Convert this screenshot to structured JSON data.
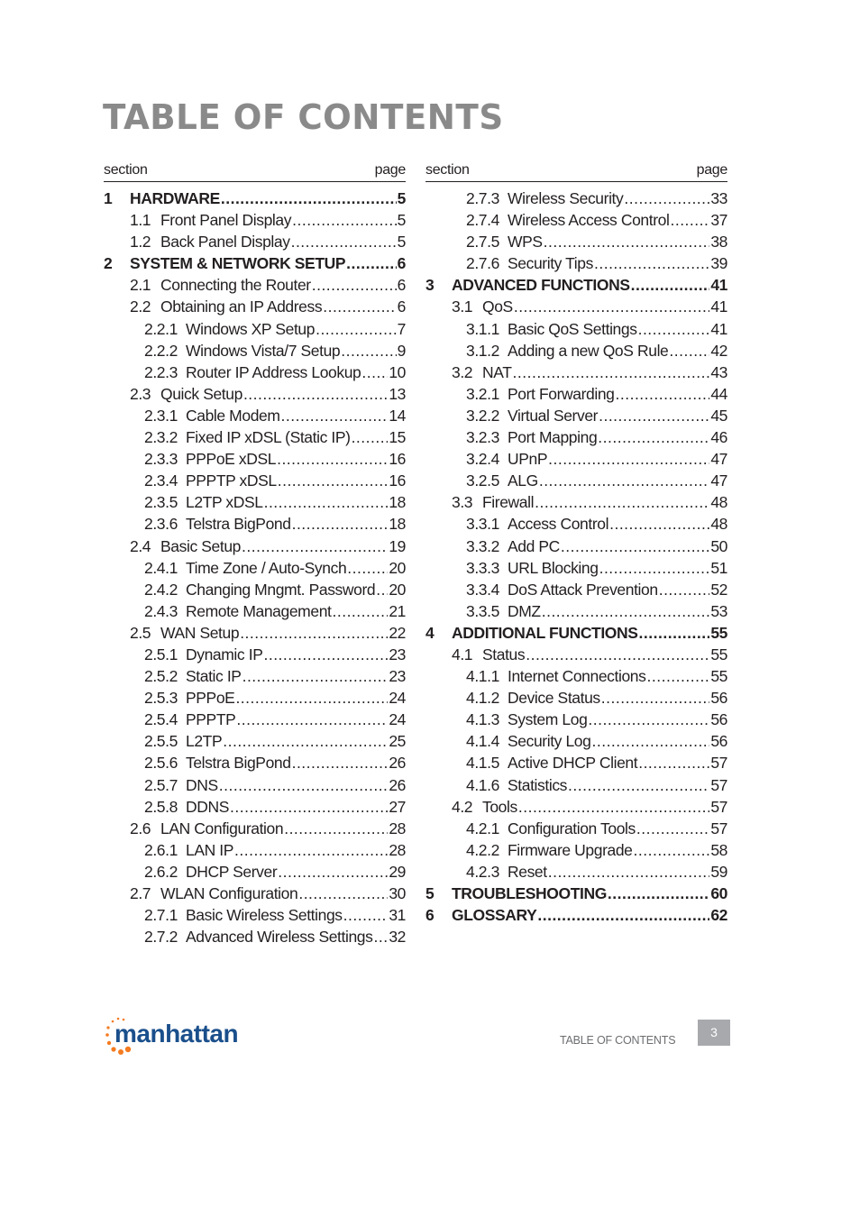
{
  "title": "TABLE OF CONTENTS",
  "column_header": {
    "section": "section",
    "page": "page"
  },
  "left": [
    {
      "level": 1,
      "num": "1",
      "label": "HARDWARE",
      "page": "5"
    },
    {
      "level": 2,
      "num": "1.1",
      "label": "Front Panel Display",
      "page": "5"
    },
    {
      "level": 2,
      "num": "1.2",
      "label": "Back Panel Display",
      "page": "5"
    },
    {
      "level": 1,
      "num": "2",
      "label": "SYSTEM & NETWORK SETUP",
      "page": "6"
    },
    {
      "level": 2,
      "num": "2.1",
      "label": "Connecting the Router",
      "page": "6"
    },
    {
      "level": 2,
      "num": "2.2",
      "label": "Obtaining an IP Address",
      "page": "6"
    },
    {
      "level": 3,
      "num": "2.2.1",
      "label": "Windows XP Setup",
      "page": "7"
    },
    {
      "level": 3,
      "num": "2.2.2",
      "label": "Windows Vista/7 Setup",
      "page": "9"
    },
    {
      "level": 3,
      "num": "2.2.3",
      "label": "Router IP Address Lookup",
      "page": "10"
    },
    {
      "level": 2,
      "num": "2.3",
      "label": "Quick Setup",
      "page": "13"
    },
    {
      "level": 3,
      "num": "2.3.1",
      "label": "Cable Modem",
      "page": "14"
    },
    {
      "level": 3,
      "num": "2.3.2",
      "label": "Fixed IP xDSL (Static IP)",
      "page": "15"
    },
    {
      "level": 3,
      "num": "2.3.3",
      "label": "PPPoE xDSL",
      "page": "16"
    },
    {
      "level": 3,
      "num": "2.3.4",
      "label": "PPPTP xDSL",
      "page": "16"
    },
    {
      "level": 3,
      "num": "2.3.5",
      "label": "L2TP xDSL",
      "page": "18"
    },
    {
      "level": 3,
      "num": "2.3.6",
      "label": "Telstra BigPond",
      "page": "18"
    },
    {
      "level": 2,
      "num": "2.4",
      "label": "Basic Setup",
      "page": "19"
    },
    {
      "level": 3,
      "num": "2.4.1",
      "label": "Time Zone / Auto-Synch",
      "page": "20"
    },
    {
      "level": 3,
      "num": "2.4.2",
      "label": "Changing Mngmt. Password",
      "page": "20"
    },
    {
      "level": 3,
      "num": "2.4.3",
      "label": "Remote Management",
      "page": "21"
    },
    {
      "level": 2,
      "num": "2.5",
      "label": "WAN Setup",
      "page": "22"
    },
    {
      "level": 3,
      "num": "2.5.1",
      "label": "Dynamic IP",
      "page": "23"
    },
    {
      "level": 3,
      "num": "2.5.2",
      "label": "Static IP",
      "page": "23"
    },
    {
      "level": 3,
      "num": "2.5.3",
      "label": "PPPoE",
      "page": "24"
    },
    {
      "level": 3,
      "num": "2.5.4",
      "label": "PPPTP",
      "page": "24"
    },
    {
      "level": 3,
      "num": "2.5.5",
      "label": "L2TP",
      "page": "25"
    },
    {
      "level": 3,
      "num": "2.5.6",
      "label": "Telstra BigPond",
      "page": "26"
    },
    {
      "level": 3,
      "num": "2.5.7",
      "label": "DNS",
      "page": "26"
    },
    {
      "level": 3,
      "num": "2.5.8",
      "label": "DDNS",
      "page": "27"
    },
    {
      "level": 2,
      "num": "2.6",
      "label": "LAN Configuration",
      "page": "28"
    },
    {
      "level": 3,
      "num": "2.6.1",
      "label": "LAN IP",
      "page": "28"
    },
    {
      "level": 3,
      "num": "2.6.2",
      "label": "DHCP Server",
      "page": "29"
    },
    {
      "level": 2,
      "num": "2.7",
      "label": "WLAN Configuration",
      "page": "30"
    },
    {
      "level": 3,
      "num": "2.7.1",
      "label": "Basic Wireless Settings",
      "page": "31"
    },
    {
      "level": 3,
      "num": "2.7.2",
      "label": "Advanced Wireless Settings",
      "page": "32"
    }
  ],
  "right": [
    {
      "level": 3,
      "num": "2.7.3",
      "label": "Wireless Security",
      "page": "33"
    },
    {
      "level": 3,
      "num": "2.7.4",
      "label": "Wireless Access Control",
      "page": "37"
    },
    {
      "level": 3,
      "num": "2.7.5",
      "label": "WPS",
      "page": "38"
    },
    {
      "level": 3,
      "num": "2.7.6",
      "label": "Security Tips",
      "page": "39"
    },
    {
      "level": 1,
      "num": "3",
      "label": "ADVANCED FUNCTIONS",
      "page": "41"
    },
    {
      "level": 2,
      "num": "3.1",
      "label": "QoS",
      "page": "41"
    },
    {
      "level": 3,
      "num": "3.1.1",
      "label": "Basic QoS Settings",
      "page": "41"
    },
    {
      "level": 3,
      "num": "3.1.2",
      "label": "Adding a new QoS Rule",
      "page": "42"
    },
    {
      "level": 2,
      "num": "3.2",
      "label": "NAT",
      "page": "43"
    },
    {
      "level": 3,
      "num": "3.2.1",
      "label": "Port Forwarding",
      "page": "44"
    },
    {
      "level": 3,
      "num": "3.2.2",
      "label": "Virtual Server",
      "page": "45"
    },
    {
      "level": 3,
      "num": "3.2.3",
      "label": "Port Mapping",
      "page": "46"
    },
    {
      "level": 3,
      "num": "3.2.4",
      "label": "UPnP",
      "page": "47"
    },
    {
      "level": 3,
      "num": "3.2.5",
      "label": "ALG",
      "page": "47"
    },
    {
      "level": 2,
      "num": "3.3",
      "label": "Firewall",
      "page": "48"
    },
    {
      "level": 3,
      "num": "3.3.1",
      "label": "Access Control",
      "page": "48"
    },
    {
      "level": 3,
      "num": "3.3.2",
      "label": "Add PC",
      "page": "50"
    },
    {
      "level": 3,
      "num": "3.3.3",
      "label": "URL Blocking",
      "page": "51"
    },
    {
      "level": 3,
      "num": "3.3.4",
      "label": "DoS Attack Prevention",
      "page": "52"
    },
    {
      "level": 3,
      "num": "3.3.5",
      "label": "DMZ",
      "page": "53"
    },
    {
      "level": 1,
      "num": "4",
      "label": "ADDITIONAL FUNCTIONS",
      "page": "55"
    },
    {
      "level": 2,
      "num": "4.1",
      "label": "Status",
      "page": "55"
    },
    {
      "level": 3,
      "num": "4.1.1",
      "label": "Internet Connections",
      "page": "55"
    },
    {
      "level": 3,
      "num": "4.1.2",
      "label": "Device Status",
      "page": "56"
    },
    {
      "level": 3,
      "num": "4.1.3",
      "label": "System Log",
      "page": "56"
    },
    {
      "level": 3,
      "num": "4.1.4",
      "label": "Security Log",
      "page": "56"
    },
    {
      "level": 3,
      "num": "4.1.5",
      "label": "Active DHCP Client",
      "page": "57"
    },
    {
      "level": 3,
      "num": "4.1.6",
      "label": "Statistics",
      "page": "57"
    },
    {
      "level": 2,
      "num": "4.2",
      "label": "Tools",
      "page": "57"
    },
    {
      "level": 3,
      "num": "4.2.1",
      "label": "Configuration Tools",
      "page": "57"
    },
    {
      "level": 3,
      "num": "4.2.2",
      "label": "Firmware Upgrade",
      "page": "58"
    },
    {
      "level": 3,
      "num": "4.2.3",
      "label": "Reset",
      "page": "59"
    },
    {
      "level": 1,
      "num": "5",
      "label": "TROUBLESHOOTING",
      "page": "60"
    },
    {
      "level": 1,
      "num": "6",
      "label": "GLOSSARY",
      "page": "62"
    }
  ],
  "footer": {
    "logo": "manhattan",
    "section_label": "TABLE OF CONTENTS",
    "page_number": "3"
  },
  "colors": {
    "title": "#8a8a8a",
    "logo_text": "#1a4f8b",
    "logo_dots": "#f47b20",
    "page_box": "#a7a9ac"
  }
}
